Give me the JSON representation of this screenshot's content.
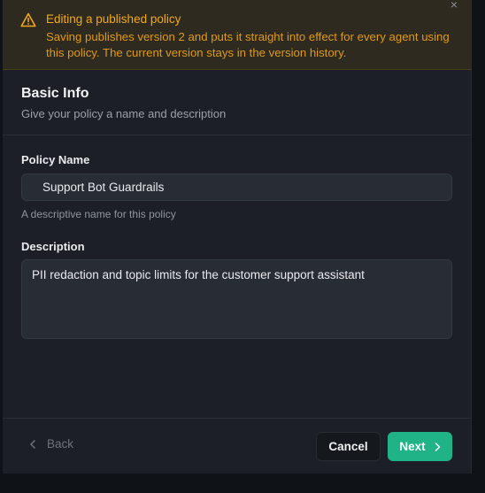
{
  "banner": {
    "title": "Editing a published policy",
    "body": "Saving publishes version 2 and puts it straight into effect for every agent using this policy. The current version stays in the version history.",
    "icon": "warning-triangle-icon",
    "accent_color": "#f0a91c"
  },
  "close_label": "×",
  "section": {
    "title": "Basic Info",
    "subtitle": "Give your policy a name and description"
  },
  "fields": {
    "name": {
      "label": "Policy Name",
      "value": "Support Bot Guardrails",
      "hint": "A descriptive name for this policy"
    },
    "description": {
      "label": "Description",
      "value": "PII redaction and topic limits for the customer support assistant"
    }
  },
  "footer": {
    "back_label": "Back",
    "cancel_label": "Cancel",
    "next_label": "Next",
    "next_color": "#1fb387"
  }
}
